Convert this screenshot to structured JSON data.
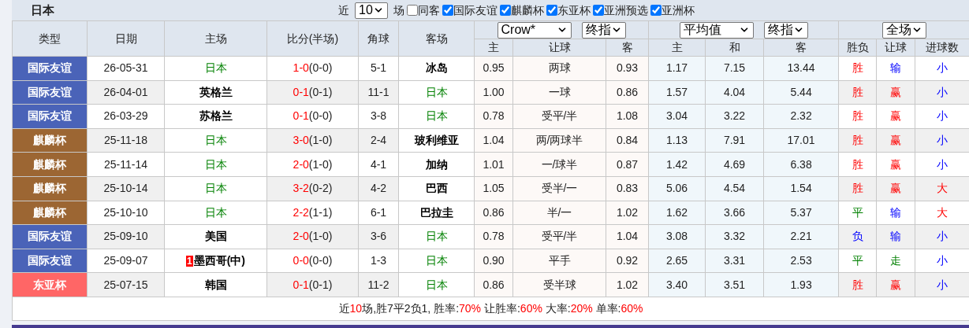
{
  "title": "日本",
  "filters": {
    "recent_label": "近",
    "recent_count": "10",
    "unit": "场",
    "options": [
      {
        "label": "同客",
        "checked": false
      },
      {
        "label": "国际友谊",
        "checked": true
      },
      {
        "label": "麒麟杯",
        "checked": true
      },
      {
        "label": "东亚杯",
        "checked": true
      },
      {
        "label": "亚洲预选",
        "checked": true
      },
      {
        "label": "亚洲杯",
        "checked": true
      }
    ]
  },
  "columns": [
    "类型",
    "日期",
    "主场",
    "比分(半场)",
    "角球",
    "客场"
  ],
  "odds_groups": [
    {
      "selects": [
        "Crow*",
        "终指"
      ]
    },
    {
      "selects": [
        "平均值",
        "终指"
      ]
    },
    {
      "selects": [
        "全场"
      ]
    }
  ],
  "sub_columns": [
    "主",
    "让球",
    "客",
    "主",
    "和",
    "客",
    "胜负",
    "让球",
    "进球数"
  ],
  "rows": [
    {
      "type": "国际友谊",
      "color": "#4a63b8",
      "date": "26-05-31",
      "home": {
        "name": "日本",
        "highlight": true
      },
      "score": "1-0",
      "half": "(0-0)",
      "corners": "5-1",
      "away": {
        "name": "冰岛",
        "highlight": false
      },
      "odds": [
        "0.95",
        "两球",
        "0.93",
        "1.17",
        "7.15",
        "13.44"
      ],
      "results": [
        {
          "text": "胜",
          "kind": "positive"
        },
        {
          "text": "输",
          "kind": "negative"
        },
        {
          "text": "小",
          "kind": "negative"
        }
      ]
    },
    {
      "type": "国际友谊",
      "color": "#4a63b8",
      "date": "26-04-01",
      "home": {
        "name": "英格兰",
        "highlight": false
      },
      "score": "0-1",
      "half": "(0-1)",
      "corners": "11-1",
      "away": {
        "name": "日本",
        "highlight": true
      },
      "odds": [
        "1.00",
        "一球",
        "0.86",
        "1.57",
        "4.04",
        "5.44"
      ],
      "results": [
        {
          "text": "胜",
          "kind": "positive"
        },
        {
          "text": "赢",
          "kind": "positive"
        },
        {
          "text": "小",
          "kind": "negative"
        }
      ]
    },
    {
      "type": "国际友谊",
      "color": "#4a63b8",
      "date": "26-03-29",
      "home": {
        "name": "苏格兰",
        "highlight": false
      },
      "score": "0-1",
      "half": "(0-0)",
      "corners": "3-8",
      "away": {
        "name": "日本",
        "highlight": true
      },
      "odds": [
        "0.78",
        "受平/半",
        "1.08",
        "3.04",
        "3.22",
        "2.32"
      ],
      "results": [
        {
          "text": "胜",
          "kind": "positive"
        },
        {
          "text": "赢",
          "kind": "positive"
        },
        {
          "text": "小",
          "kind": "negative"
        }
      ]
    },
    {
      "type": "麒麟杯",
      "color": "#9c6633",
      "date": "25-11-18",
      "home": {
        "name": "日本",
        "highlight": true
      },
      "score": "3-0",
      "half": "(1-0)",
      "corners": "2-4",
      "away": {
        "name": "玻利维亚",
        "highlight": false
      },
      "odds": [
        "1.04",
        "两/两球半",
        "0.84",
        "1.13",
        "7.91",
        "17.01"
      ],
      "results": [
        {
          "text": "胜",
          "kind": "positive"
        },
        {
          "text": "赢",
          "kind": "positive"
        },
        {
          "text": "小",
          "kind": "negative"
        }
      ]
    },
    {
      "type": "麒麟杯",
      "color": "#9c6633",
      "date": "25-11-14",
      "home": {
        "name": "日本",
        "highlight": true
      },
      "score": "2-0",
      "half": "(1-0)",
      "corners": "4-1",
      "away": {
        "name": "加纳",
        "highlight": false
      },
      "odds": [
        "1.01",
        "一/球半",
        "0.87",
        "1.42",
        "4.69",
        "6.38"
      ],
      "results": [
        {
          "text": "胜",
          "kind": "positive"
        },
        {
          "text": "赢",
          "kind": "positive"
        },
        {
          "text": "小",
          "kind": "negative"
        }
      ]
    },
    {
      "type": "麒麟杯",
      "color": "#9c6633",
      "date": "25-10-14",
      "home": {
        "name": "日本",
        "highlight": true
      },
      "score": "3-2",
      "half": "(0-2)",
      "corners": "4-2",
      "away": {
        "name": "巴西",
        "highlight": false
      },
      "odds": [
        "1.05",
        "受半/一",
        "0.83",
        "5.06",
        "4.54",
        "1.54"
      ],
      "results": [
        {
          "text": "胜",
          "kind": "positive"
        },
        {
          "text": "赢",
          "kind": "positive"
        },
        {
          "text": "大",
          "kind": "positive"
        }
      ]
    },
    {
      "type": "麒麟杯",
      "color": "#9c6633",
      "date": "25-10-10",
      "home": {
        "name": "日本",
        "highlight": true
      },
      "score": "2-2",
      "half": "(1-1)",
      "corners": "6-1",
      "away": {
        "name": "巴拉圭",
        "highlight": false
      },
      "odds": [
        "0.86",
        "半/一",
        "1.02",
        "1.62",
        "3.66",
        "5.37"
      ],
      "results": [
        {
          "text": "平",
          "kind": "neutral"
        },
        {
          "text": "输",
          "kind": "negative"
        },
        {
          "text": "大",
          "kind": "positive"
        }
      ]
    },
    {
      "type": "国际友谊",
      "color": "#4a63b8",
      "date": "25-09-10",
      "home": {
        "name": "美国",
        "highlight": false
      },
      "score": "2-0",
      "half": "(1-0)",
      "corners": "3-6",
      "away": {
        "name": "日本",
        "highlight": true
      },
      "odds": [
        "0.78",
        "受平/半",
        "1.04",
        "3.08",
        "3.32",
        "2.21"
      ],
      "results": [
        {
          "text": "负",
          "kind": "negative"
        },
        {
          "text": "输",
          "kind": "negative"
        },
        {
          "text": "小",
          "kind": "negative"
        }
      ]
    },
    {
      "type": "国际友谊",
      "color": "#4a63b8",
      "date": "25-09-07",
      "home": {
        "name": "墨西哥(中)",
        "highlight": false,
        "card": "1"
      },
      "score": "0-0",
      "half": "(0-0)",
      "corners": "1-3",
      "away": {
        "name": "日本",
        "highlight": true
      },
      "odds": [
        "0.90",
        "平手",
        "0.92",
        "2.65",
        "3.31",
        "2.53"
      ],
      "results": [
        {
          "text": "平",
          "kind": "neutral"
        },
        {
          "text": "走",
          "kind": "neutral"
        },
        {
          "text": "小",
          "kind": "negative"
        }
      ]
    },
    {
      "type": "东亚杯",
      "color": "#ff6666",
      "date": "25-07-15",
      "home": {
        "name": "韩国",
        "highlight": false
      },
      "score": "0-1",
      "half": "(0-1)",
      "corners": "11-2",
      "away": {
        "name": "日本",
        "highlight": true
      },
      "odds": [
        "0.86",
        "受半球",
        "1.02",
        "3.40",
        "3.51",
        "1.93"
      ],
      "results": [
        {
          "text": "胜",
          "kind": "positive"
        },
        {
          "text": "赢",
          "kind": "positive"
        },
        {
          "text": "小",
          "kind": "negative"
        }
      ]
    }
  ],
  "summary": [
    {
      "text": "近",
      "highlight": false
    },
    {
      "text": "10",
      "highlight": true
    },
    {
      "text": "场,胜7平2负1, 胜率:",
      "highlight": false
    },
    {
      "text": "70%",
      "highlight": true
    },
    {
      "text": " 让胜率:",
      "highlight": false
    },
    {
      "text": "60%",
      "highlight": true
    },
    {
      "text": " 大率:",
      "highlight": false
    },
    {
      "text": "20%",
      "highlight": true
    },
    {
      "text": " 单率:",
      "highlight": false
    },
    {
      "text": "60%",
      "highlight": true
    }
  ]
}
